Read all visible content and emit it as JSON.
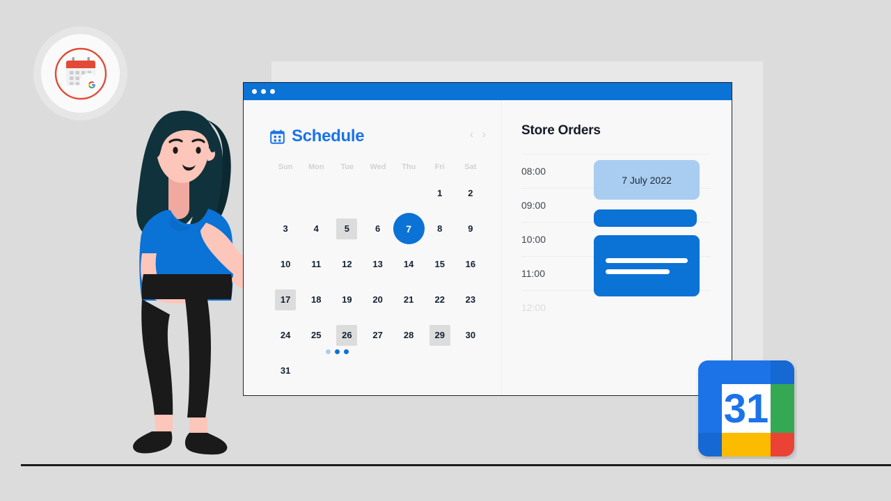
{
  "colors": {
    "background": "#dcdcdc",
    "brand_blue": "#0b72d6",
    "title_blue": "#1a73e8",
    "event_light_blue": "#a9cdf0",
    "marked_day": "#dcdcdc",
    "text_dark": "#132033",
    "muted": "#cfd2d5",
    "ground_line": "#1b1b1b",
    "back_panel": "#e8e8e8",
    "window_bg": "#f8f8f8",
    "google_blue": "#1a73e8",
    "google_green": "#34a853",
    "google_yellow": "#fbbc04",
    "google_red": "#ea4335",
    "skin": "#f8c2b8",
    "hair": "#10323c",
    "shirt": "#0b72d6",
    "pants": "#1a1a1a"
  },
  "badge": {
    "icon_name": "google-calendar-classic-icon"
  },
  "window": {
    "titlebar_dots": 3
  },
  "schedule": {
    "icon_name": "calendar-icon",
    "title": "Schedule",
    "prev_label": "‹",
    "next_label": "›",
    "weekdays": [
      "Sun",
      "Mon",
      "Tue",
      "Wed",
      "Thu",
      "Fri",
      "Sat"
    ],
    "leading_blanks": 5,
    "days": [
      {
        "n": "1",
        "state": "normal"
      },
      {
        "n": "2",
        "state": "normal"
      },
      {
        "n": "3",
        "state": "normal"
      },
      {
        "n": "4",
        "state": "normal"
      },
      {
        "n": "5",
        "state": "marked"
      },
      {
        "n": "6",
        "state": "normal"
      },
      {
        "n": "7",
        "state": "today"
      },
      {
        "n": "8",
        "state": "normal"
      },
      {
        "n": "9",
        "state": "normal"
      },
      {
        "n": "10",
        "state": "normal"
      },
      {
        "n": "11",
        "state": "normal"
      },
      {
        "n": "12",
        "state": "normal"
      },
      {
        "n": "13",
        "state": "normal"
      },
      {
        "n": "14",
        "state": "normal"
      },
      {
        "n": "15",
        "state": "normal"
      },
      {
        "n": "16",
        "state": "normal"
      },
      {
        "n": "17",
        "state": "marked"
      },
      {
        "n": "18",
        "state": "normal"
      },
      {
        "n": "19",
        "state": "normal"
      },
      {
        "n": "20",
        "state": "normal"
      },
      {
        "n": "21",
        "state": "normal"
      },
      {
        "n": "22",
        "state": "normal"
      },
      {
        "n": "23",
        "state": "normal"
      },
      {
        "n": "24",
        "state": "normal"
      },
      {
        "n": "25",
        "state": "normal"
      },
      {
        "n": "26",
        "state": "marked"
      },
      {
        "n": "27",
        "state": "normal"
      },
      {
        "n": "28",
        "state": "normal"
      },
      {
        "n": "29",
        "state": "marked"
      },
      {
        "n": "30",
        "state": "normal"
      },
      {
        "n": "31",
        "state": "normal"
      }
    ],
    "event_dots": [
      "#a9cdf0",
      "#0b72d6",
      "#0b72d6"
    ]
  },
  "orders": {
    "title": "Store Orders",
    "times": [
      {
        "label": "08:00",
        "faded": false
      },
      {
        "label": "09:00",
        "faded": false
      },
      {
        "label": "10:00",
        "faded": false
      },
      {
        "label": "11:00",
        "faded": false
      },
      {
        "label": "12:00",
        "faded": true
      }
    ],
    "events": [
      {
        "id": "ev-0",
        "label": "7 July 2022",
        "style": "light"
      },
      {
        "id": "ev-1",
        "label": "",
        "style": "solid-small"
      },
      {
        "id": "ev-2",
        "label": "",
        "style": "solid-large"
      }
    ]
  },
  "gcal_icon": {
    "name": "google-calendar-icon",
    "day_number": "31"
  },
  "character": {
    "name": "woman-pointing-illustration"
  }
}
